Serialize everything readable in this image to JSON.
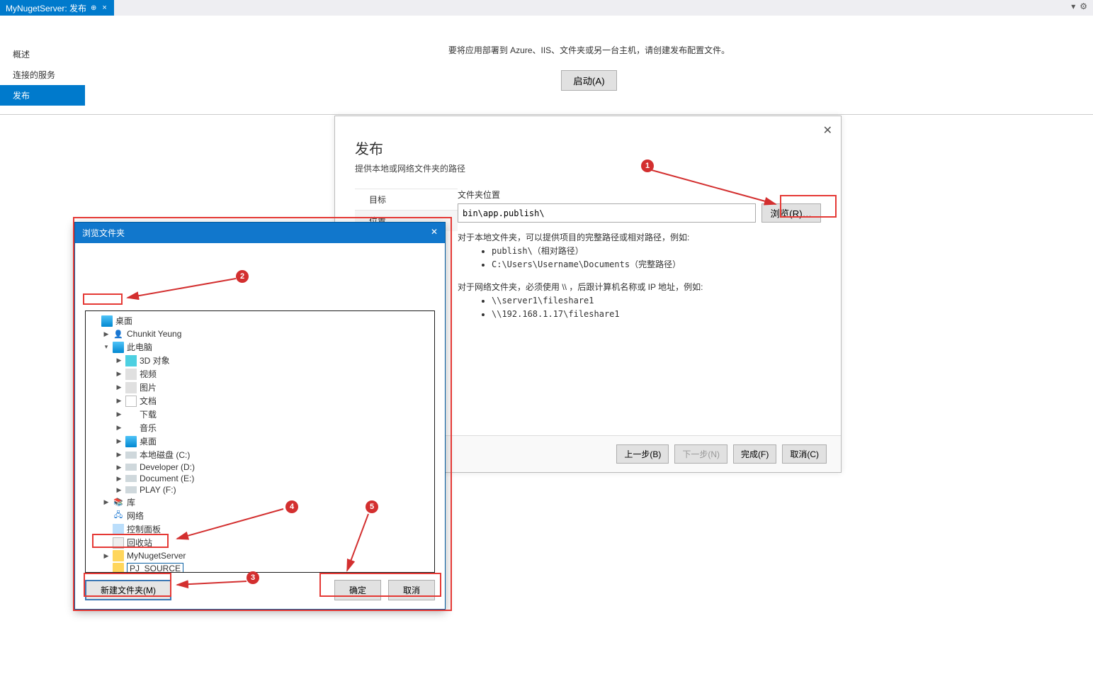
{
  "tab": {
    "title": "MyNugetServer: 发布",
    "pin": "⊕",
    "close": "×"
  },
  "tabbar_icons": {
    "dropdown": "▾",
    "gear": "⚙"
  },
  "sidebar": {
    "overview": "概述",
    "connected": "连接的服务",
    "publish": "发布"
  },
  "center": {
    "msg": "要将应用部署到 Azure、IIS、文件夹或另一台主机，请创建发布配置文件。",
    "start": "启动(A)"
  },
  "publish_dialog": {
    "title": "发布",
    "subtitle": "提供本地或网络文件夹的路径",
    "close": "✕",
    "left": {
      "target": "目标",
      "location": "位置"
    },
    "folder_label": "文件夹位置",
    "folder_value": "bin\\app.publish\\",
    "browse": "浏览(R)…",
    "help_local": "对于本地文件夹，可以提供项目的完整路径或相对路径，例如:",
    "help_local_ex1": "publish\\（相对路径）",
    "help_local_ex2": "C:\\Users\\Username\\Documents（完整路径）",
    "help_net": "对于网络文件夹，必须使用 \\\\ ，后跟计算机名称或 IP 地址，例如:",
    "help_net_ex1": "\\\\server1\\fileshare1",
    "help_net_ex2": "\\\\192.168.1.17\\fileshare1",
    "back": "上一步(B)",
    "next": "下一步(N)",
    "finish": "完成(F)",
    "cancel": "取消(C)"
  },
  "browse_dialog": {
    "title": "浏览文件夹",
    "close": "✕",
    "tree": {
      "desktop": "桌面",
      "user": "Chunkit Yeung",
      "this_pc": "此电脑",
      "items": [
        {
          "label": "3D 对象",
          "icon": "folder3d"
        },
        {
          "label": "视频",
          "icon": "video"
        },
        {
          "label": "图片",
          "icon": "pic"
        },
        {
          "label": "文档",
          "icon": "doc"
        },
        {
          "label": "下载",
          "icon": "download"
        },
        {
          "label": "音乐",
          "icon": "music"
        },
        {
          "label": "桌面",
          "icon": "monitor"
        },
        {
          "label": "本地磁盘 (C:)",
          "icon": "disk"
        },
        {
          "label": "Developer (D:)",
          "icon": "disk"
        },
        {
          "label": "Document (E:)",
          "icon": "disk"
        },
        {
          "label": "PLAY (F:)",
          "icon": "disk"
        }
      ],
      "library": "库",
      "network": "网络",
      "control": "控制面板",
      "recycle": "回收站",
      "nuget": "MyNugetServer",
      "newname": "PJ_SOURCE"
    },
    "new_folder": "新建文件夹(M)",
    "ok": "确定",
    "cancel": "取消"
  },
  "annotations": {
    "a1": "1",
    "a2": "2",
    "a3": "3",
    "a4": "4",
    "a5": "5"
  }
}
